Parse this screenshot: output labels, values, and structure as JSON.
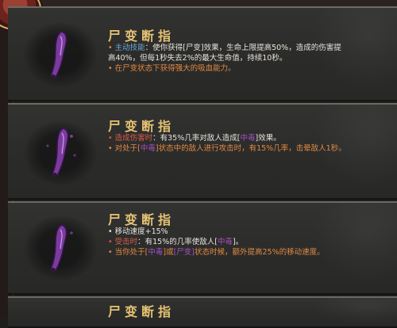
{
  "cards": [
    {
      "title": "尸变断指",
      "lines": [
        {
          "parts": [
            {
              "t": "• ",
              "c": "orange"
            },
            {
              "t": "主动技能",
              "c": "blue"
            },
            {
              "t": "：使你获得[",
              "c": "white"
            },
            {
              "t": "尸变",
              "c": "white"
            },
            {
              "t": "]效果，生命上限提高50%，造成的伤害提",
              "c": "white"
            }
          ]
        },
        {
          "parts": [
            {
              "t": "高40%，但每1秒失去2%的最大生命值，持续10秒。",
              "c": "white"
            }
          ]
        },
        {
          "parts": [
            {
              "t": "• ",
              "c": "orange"
            },
            {
              "t": "在尸变状态下获得强大的吸血能力。",
              "c": "orange"
            }
          ]
        }
      ]
    },
    {
      "title": "尸变断指",
      "lines": [
        {
          "parts": [
            {
              "t": "• ",
              "c": "red"
            },
            {
              "t": "造成伤害时",
              "c": "red"
            },
            {
              "t": "：有35%几率对敌人造成[",
              "c": "white"
            },
            {
              "t": "中毒",
              "c": "purple"
            },
            {
              "t": "]效果。",
              "c": "white"
            }
          ]
        },
        {
          "parts": [
            {
              "t": "• ",
              "c": "orange"
            },
            {
              "t": "对处于[",
              "c": "orange"
            },
            {
              "t": "中毒",
              "c": "purple"
            },
            {
              "t": "]状态中的敌人进行攻击时，有15%几率，击晕敌人1秒。",
              "c": "orange"
            }
          ]
        }
      ]
    },
    {
      "title": "尸变断指",
      "lines": [
        {
          "parts": [
            {
              "t": "• ",
              "c": "white"
            },
            {
              "t": "移动速度+15%",
              "c": "white"
            }
          ]
        },
        {
          "parts": [
            {
              "t": "• ",
              "c": "red"
            },
            {
              "t": "受击时",
              "c": "red"
            },
            {
              "t": "：有15%的几率使敌人[",
              "c": "white"
            },
            {
              "t": "中毒",
              "c": "purple"
            },
            {
              "t": "]。",
              "c": "white"
            }
          ]
        },
        {
          "parts": [
            {
              "t": "• ",
              "c": "orange"
            },
            {
              "t": "当你处于[",
              "c": "orange"
            },
            {
              "t": "中毒",
              "c": "purple"
            },
            {
              "t": "]或",
              "c": "orange"
            },
            {
              "t": "[尸变]",
              "c": "purple"
            },
            {
              "t": "状态时候，额外提高25%的移动速度。",
              "c": "orange"
            }
          ]
        }
      ]
    },
    {
      "title": "尸变断指",
      "lines": []
    }
  ],
  "colors": {
    "title": "#e6c372",
    "skill_blue": "#6fa7d8",
    "trigger_red": "#d85b4a",
    "effect_orange": "#e08a42",
    "poison_purple": "#a44fc4"
  },
  "icons": [
    "severed-finger-icon",
    "severed-finger-icon",
    "severed-finger-icon"
  ]
}
